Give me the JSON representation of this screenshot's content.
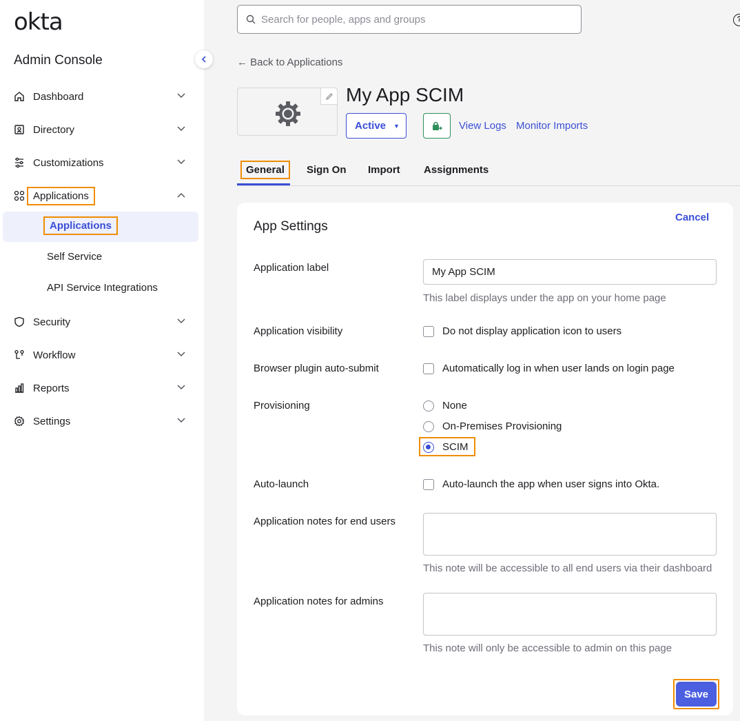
{
  "brand": {
    "logo_text": "okta",
    "console_title": "Admin Console",
    "accent": "#3a4fd6",
    "highlight": "#f08c00"
  },
  "sidebar": {
    "items": [
      {
        "label": "Dashboard",
        "icon": "home-icon"
      },
      {
        "label": "Directory",
        "icon": "directory-icon"
      },
      {
        "label": "Customizations",
        "icon": "sliders-icon"
      },
      {
        "label": "Applications",
        "icon": "apps-grid-icon",
        "expanded": true
      },
      {
        "label": "Security",
        "icon": "shield-icon"
      },
      {
        "label": "Workflow",
        "icon": "workflow-icon"
      },
      {
        "label": "Reports",
        "icon": "bar-chart-icon"
      },
      {
        "label": "Settings",
        "icon": "gear-icon"
      }
    ],
    "subitems": [
      {
        "label": "Applications",
        "active": true
      },
      {
        "label": "Self Service"
      },
      {
        "label": "API Service Integrations"
      }
    ]
  },
  "search": {
    "placeholder": "Search for people, apps and groups"
  },
  "back_link": "← Back to Applications",
  "app": {
    "title": "My App SCIM",
    "status": "Active",
    "links": {
      "view_logs": "View Logs",
      "monitor_imports": "Monitor Imports"
    }
  },
  "tabs": [
    {
      "label": "General",
      "active": true
    },
    {
      "label": "Sign On"
    },
    {
      "label": "Import"
    },
    {
      "label": "Assignments"
    }
  ],
  "settings": {
    "title": "App Settings",
    "cancel": "Cancel",
    "app_label": {
      "label": "Application label",
      "value": "My App SCIM",
      "help": "This label displays under the app on your home page"
    },
    "visibility": {
      "label": "Application visibility",
      "option": "Do not display application icon to users",
      "checked": false
    },
    "browser_plugin": {
      "label": "Browser plugin auto-submit",
      "option": "Automatically log in when user lands on login page",
      "checked": false
    },
    "provisioning": {
      "label": "Provisioning",
      "options": [
        "None",
        "On-Premises Provisioning",
        "SCIM"
      ],
      "selected": "SCIM"
    },
    "auto_launch": {
      "label": "Auto-launch",
      "option": "Auto-launch the app when user signs into Okta.",
      "checked": false
    },
    "notes_users": {
      "label": "Application notes for end users",
      "help": "This note will be accessible to all end users via their dashboard"
    },
    "notes_admins": {
      "label": "Application notes for admins",
      "help": "This note will only be accessible to admin on this page"
    },
    "save": "Save"
  }
}
